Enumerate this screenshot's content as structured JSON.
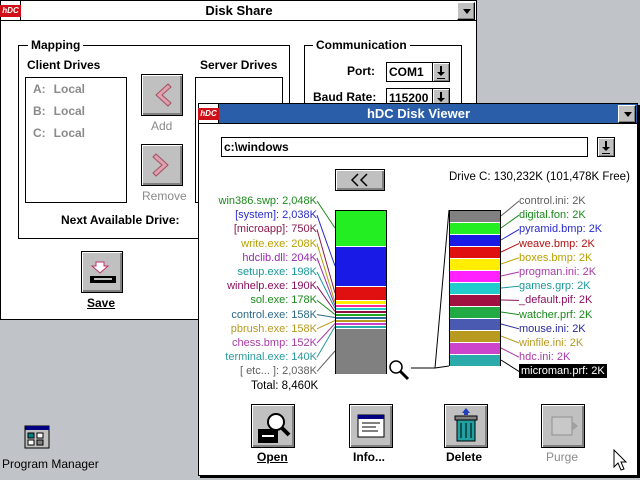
{
  "desktop": {
    "program_manager_label": "Program Manager"
  },
  "disk_share": {
    "title": "Disk Share",
    "mapping_label": "Mapping",
    "client_drives_label": "Client Drives",
    "server_drives_label": "Server Drives",
    "client_drives": [
      {
        "letter": "A:",
        "name": "Local"
      },
      {
        "letter": "B:",
        "name": "Local"
      },
      {
        "letter": "C:",
        "name": "Local"
      }
    ],
    "add_label": "Add",
    "remove_label": "Remove",
    "next_available_label": "Next Available Drive:",
    "save_label": "Save",
    "communication_label": "Communication",
    "port_label": "Port:",
    "port_value": "COM1",
    "baud_label": "Baud Rate:",
    "baud_value": "115200"
  },
  "disk_viewer": {
    "title": "hDC Disk Viewer",
    "logo_text": "hDC",
    "path_value": "c:\\windows",
    "drive_info": "Drive C: 130,232K (101,478K Free)",
    "total_label": "Total: 8,460K",
    "left_items": [
      {
        "label": "win386.swp: 2,048K",
        "color": "#1a8a1a"
      },
      {
        "label": "[system]: 2,038K",
        "color": "#2a2acc"
      },
      {
        "label": "[microapp]: 750K",
        "color": "#8a1a4a"
      },
      {
        "label": "write.exe: 208K",
        "color": "#b8a000"
      },
      {
        "label": "hdclib.dll: 204K",
        "color": "#9a2ab0"
      },
      {
        "label": "setup.exe: 198K",
        "color": "#1a9a9a"
      },
      {
        "label": "winhelp.exe: 190K",
        "color": "#8a1060"
      },
      {
        "label": "sol.exe: 178K",
        "color": "#1a8a1a"
      },
      {
        "label": "control.exe: 158K",
        "color": "#2a6a8a"
      },
      {
        "label": "pbrush.exe: 158K",
        "color": "#b89a20"
      },
      {
        "label": "chess.bmp: 152K",
        "color": "#aa3aaa"
      },
      {
        "label": "terminal.exe: 140K",
        "color": "#2a9a9a"
      },
      {
        "label": "[ etc... ]: 2,038K",
        "color": "#606060"
      }
    ],
    "right_items": [
      {
        "label": "control.ini: 2K",
        "color": "#606060"
      },
      {
        "label": "digital.fon: 2K",
        "color": "#1a8a1a"
      },
      {
        "label": "pyramid.bmp: 2K",
        "color": "#2a2acc"
      },
      {
        "label": "weave.bmp: 2K",
        "color": "#b01010"
      },
      {
        "label": "boxes.bmp: 2K",
        "color": "#b8a000"
      },
      {
        "label": "progman.ini: 2K",
        "color": "#aa3aaa"
      },
      {
        "label": "games.grp: 2K",
        "color": "#1a9a9a"
      },
      {
        "label": "_default.pif: 2K",
        "color": "#8a1060"
      },
      {
        "label": "watcher.prf: 2K",
        "color": "#1a8a1a"
      },
      {
        "label": "mouse.ini: 2K",
        "color": "#2a2a9a"
      },
      {
        "label": "winfile.ini: 2K",
        "color": "#b89a20"
      },
      {
        "label": "hdc.ini: 2K",
        "color": "#aa3aaa"
      },
      {
        "label": "microman.prf: 2K",
        "color": "#ffffff"
      }
    ],
    "open_label": "Open",
    "info_label": "Info...",
    "delete_label": "Delete",
    "purge_label": "Purge"
  }
}
